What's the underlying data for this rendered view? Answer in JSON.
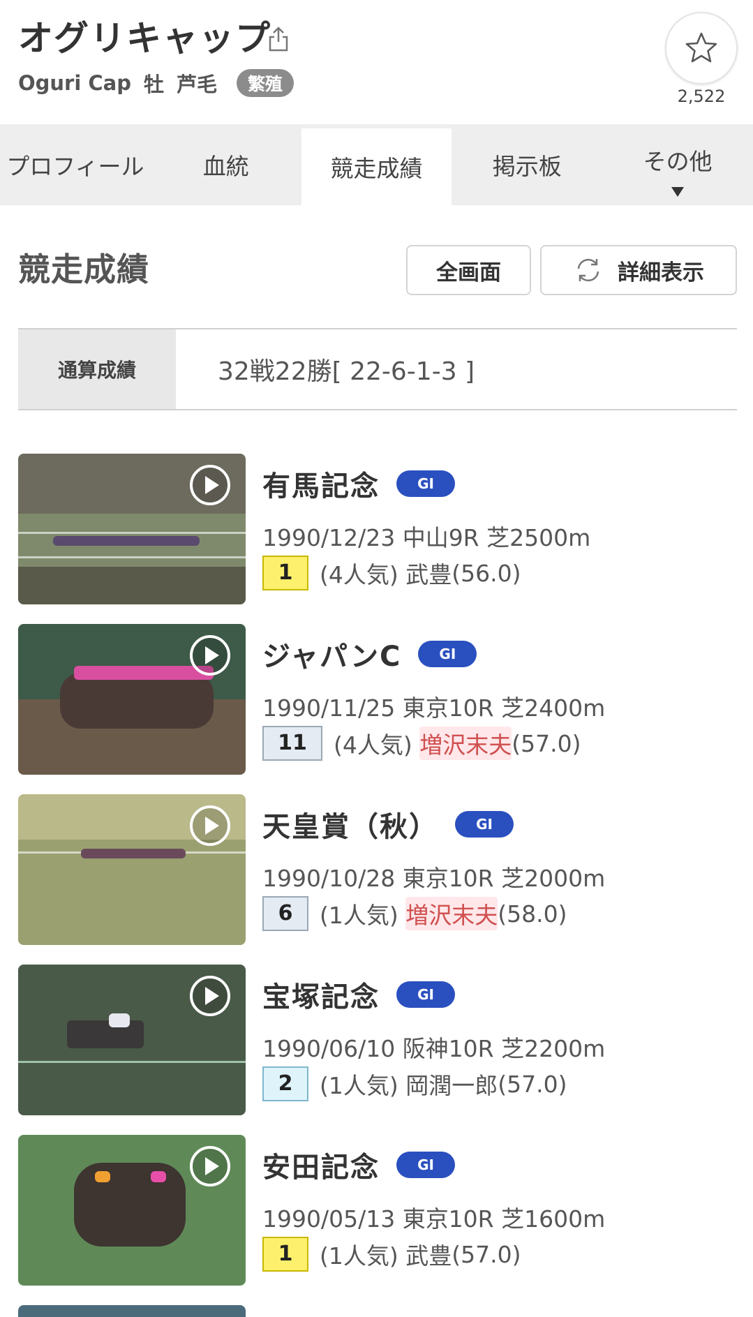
{
  "header": {
    "name": "オグリキャップ",
    "name_en": "Oguri Cap",
    "sex": "牡",
    "color": "芦毛",
    "status_badge": "繁殖",
    "fav_count": "2,522"
  },
  "tabs": [
    {
      "label": "プロフィール"
    },
    {
      "label": "血統"
    },
    {
      "label": "競走成績"
    },
    {
      "label": "掲示板"
    },
    {
      "label": "その他"
    }
  ],
  "section": {
    "title": "競走成績",
    "fullscreen_label": "全画面",
    "detail_label": "詳細表示"
  },
  "summary": {
    "label": "通算成績",
    "value": "32戦22勝[ 22-6-1-3 ]"
  },
  "races": [
    {
      "name": "有馬記念",
      "grade": "GI",
      "info": "1990/12/23 中山9R 芝2500m",
      "rank": "1",
      "popularity": "(4人気)",
      "jockey": "武豊",
      "weight": "(56.0)"
    },
    {
      "name": "ジャパンC",
      "grade": "GI",
      "info": "1990/11/25 東京10R 芝2400m",
      "rank": "11",
      "popularity": "(4人気)",
      "jockey": "増沢末夫",
      "weight": "(57.0)"
    },
    {
      "name": "天皇賞（秋）",
      "grade": "GI",
      "info": "1990/10/28 東京10R 芝2000m",
      "rank": "6",
      "popularity": "(1人気)",
      "jockey": "増沢末夫",
      "weight": "(58.0)"
    },
    {
      "name": "宝塚記念",
      "grade": "GI",
      "info": "1990/06/10 阪神10R 芝2200m",
      "rank": "2",
      "popularity": "(1人気)",
      "jockey": "岡潤一郎",
      "weight": "(57.0)"
    },
    {
      "name": "安田記念",
      "grade": "GI",
      "info": "1990/05/13 東京10R 芝1600m",
      "rank": "1",
      "popularity": "(1人気)",
      "jockey": "武豊",
      "weight": "(57.0)"
    }
  ],
  "colors": {
    "grade_badge": "#2a4fbf",
    "rank_win": "#fdf06c",
    "rank_place": "#dff3fb",
    "rank_other": "#e5ebf2"
  }
}
